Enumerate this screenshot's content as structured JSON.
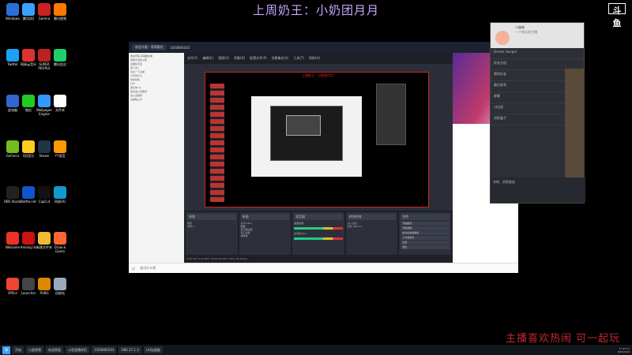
{
  "overlay": {
    "title": "上周奶王：小奶团月月",
    "slogan": "主播喜欢热闹 可一起玩",
    "logo_text": "斗鱼"
  },
  "desktop_icons": [
    {
      "label": "Windows",
      "color": "#2a6fd6"
    },
    {
      "label": "腾讯QQ",
      "color": "#3aa0ff"
    },
    {
      "label": "Garena",
      "color": "#c22"
    },
    {
      "label": "腾讯视频",
      "color": "#ff7a00"
    },
    {
      "label": "Twitter",
      "color": "#1da1f2"
    },
    {
      "label": "网易云音乐",
      "color": "#d33"
    },
    {
      "label": "SUPER PEOPLE",
      "color": "#b22"
    },
    {
      "label": "腾讯会议",
      "color": "#2c6"
    },
    {
      "label": "此电脑",
      "color": "#36c"
    },
    {
      "label": "微信",
      "color": "#2c2"
    },
    {
      "label": "Wallpaper Engine",
      "color": "#39f"
    },
    {
      "label": "文件夹",
      "color": "#fff"
    },
    {
      "label": "GeForce",
      "color": "#7b2"
    },
    {
      "label": "QQ音乐",
      "color": "#fc2"
    },
    {
      "label": "Steam",
      "color": "#234"
    },
    {
      "label": "YY语音",
      "color": "#f90"
    },
    {
      "label": "OBS Studio",
      "color": "#222"
    },
    {
      "label": "Battle.net",
      "color": "#15c"
    },
    {
      "label": "CapCut",
      "color": "#111"
    },
    {
      "label": "网易UU",
      "color": "#19c"
    },
    {
      "label": "WeGame",
      "color": "#e32"
    },
    {
      "label": "Among Us",
      "color": "#c11"
    },
    {
      "label": "新建文件夹",
      "color": "#eb3"
    },
    {
      "label": "Draw & Guess",
      "color": "#f63"
    },
    {
      "label": "Office",
      "color": "#e43"
    },
    {
      "label": "Launcher",
      "color": "#444"
    },
    {
      "label": "PUBG",
      "color": "#d80"
    },
    {
      "label": "回收站",
      "color": "#9ab"
    }
  ],
  "window": {
    "title_tab": "欢迎光临 · 哥哥都在",
    "room_id": "1450800543",
    "chat_lines": [
      "欢迎光临 哥哥都在看",
      "谢谢大哥的火箭",
      "主播好可爱",
      "来了来了",
      "关注一下主播",
      "今天玩什么",
      "哈哈哈哈",
      "打卡",
      "送礼物 x1",
      "欢迎进入直播间",
      "进入直播间",
      "主播晚上好"
    ],
    "chat_input_placeholder": "说点什么吧",
    "obs": {
      "menu": [
        "文件(F)",
        "编辑(E)",
        "视图(V)",
        "停靠(D)",
        "配置文件(P)",
        "场景集合(S)",
        "工具(T)",
        "帮助(H)"
      ],
      "window_title": "OBS 27.1.3 (64-bit, windows) - 配置文件: 未命名 - 场景: 未命名",
      "preview_title": "上周奶王：小奶团月月",
      "panels": [
        {
          "title": "场景",
          "items": [
            "场景",
            "场景 2"
          ]
        },
        {
          "title": "来源",
          "items": [
            "文字 GDI+",
            "图像",
            "显示器采集",
            "窗口采集",
            "媒体源"
          ]
        },
        {
          "title": "混音器",
          "items": [
            "桌面音频",
            "麦克风/Aux"
          ]
        },
        {
          "title": "转场特效",
          "items": [
            "淡入淡出",
            "时长 300 ms"
          ]
        },
        {
          "title": "控件",
          "items": [
            "开始推流",
            "开始录制",
            "启动虚拟摄像机",
            "工作室模式",
            "设置",
            "退出"
          ]
        }
      ],
      "status": "LIVE: 00:51:22  REC: 00:00:00  CPU: 4.9%, 60.00 fps"
    }
  },
  "right_panel": {
    "user_name": "二妹妹",
    "subtitle": "一个快乐的主播",
    "rows": [
      "Dream Hunger",
      "好友分组",
      "我的好友",
      "最近联系",
      "群聊",
      "讨论组",
      "消息盒子"
    ],
    "footer": "本地 · 消息推送"
  },
  "taskbar": {
    "items": [
      "开始",
      "火星视频",
      "欢迎界面",
      "斗鱼直播伴侣",
      "1450800543",
      "OBS 27.1.3",
      "UU加速器"
    ],
    "time": "17:47:11",
    "date": "2022/2/24"
  }
}
